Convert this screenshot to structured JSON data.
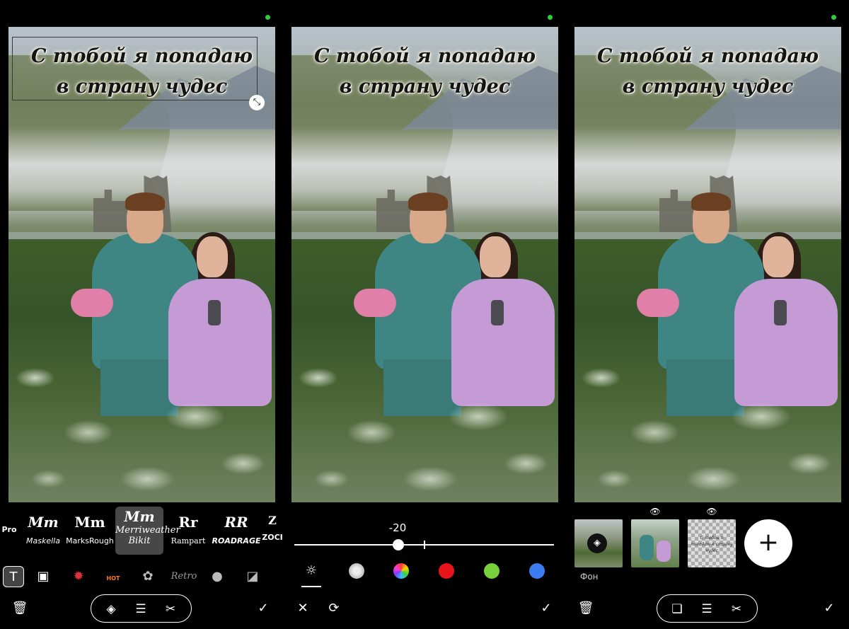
{
  "caption": {
    "line1": "С тобой я попадаю",
    "line2": "в страну чудес"
  },
  "panel1": {
    "fonts": [
      {
        "preview": "",
        "name": "Pro"
      },
      {
        "preview": "Mm",
        "name": "Maskella"
      },
      {
        "preview": "Mm",
        "name": "MarksRough"
      },
      {
        "preview": "Mm",
        "name": "Merriweather Bikit",
        "selected": true
      },
      {
        "preview": "Rr",
        "name": "Rampart"
      },
      {
        "preview": "RR",
        "name": "ROADRAGE"
      },
      {
        "preview": "Z",
        "name": "ZOCI"
      }
    ],
    "icons": [
      "text-icon",
      "image-icon",
      "badge-icon",
      "hot-icon",
      "flower-icon",
      "retro-icon",
      "person-icon",
      "sticker-icon"
    ],
    "hot_label": "HOT",
    "retro_label": "Retro",
    "bottom": [
      "delete-icon",
      "fill-icon",
      "adjust-icon",
      "cut-icon",
      "confirm-icon"
    ]
  },
  "panel2": {
    "slider_value": "-20",
    "slider_fraction": 0.4,
    "adjustments": [
      {
        "icon": "brightness-icon",
        "color": "#ffffff"
      },
      {
        "icon": "texture-icon",
        "color": "#cccccc"
      },
      {
        "icon": "palette-icon",
        "color": "#ff55aa"
      },
      {
        "icon": "red-color",
        "color": "#e8141a"
      },
      {
        "icon": "green-color",
        "color": "#76d13a"
      },
      {
        "icon": "blue-color",
        "color": "#3d7cf0"
      }
    ],
    "bottom": [
      "cancel-icon",
      "reset-icon",
      "confirm-icon"
    ]
  },
  "panel3": {
    "background_label": "Фон",
    "add_label": "+",
    "thumb_text": "С тобой я попадаю в страну чудес",
    "bottom": [
      "delete-icon",
      "square-icon",
      "adjust-icon",
      "cut-icon",
      "confirm-icon"
    ]
  },
  "colors": {
    "accent": "#2ecc40",
    "toolbar_bg": "#000000",
    "selected_font_bg": "#474747"
  }
}
